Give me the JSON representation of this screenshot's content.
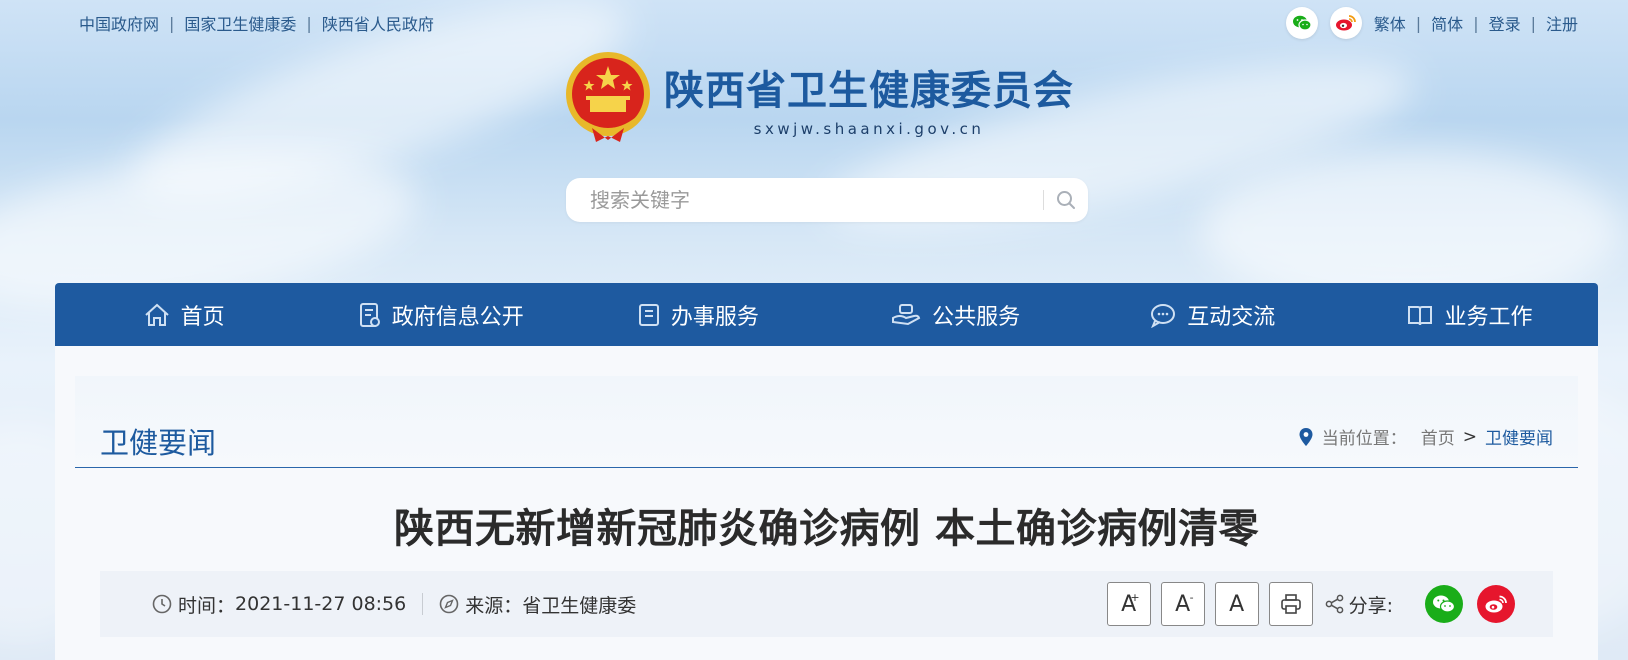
{
  "top_links": [
    "中国政府网",
    "国家卫生健康委",
    "陕西省人民政府"
  ],
  "top_right": {
    "traditional": "繁体",
    "simplified": "简体",
    "login": "登录",
    "register": "注册"
  },
  "logo": {
    "title": "陕西省卫生健康委员会",
    "domain": "sxwjw.shaanxi.gov.cn"
  },
  "search": {
    "placeholder": "搜索关键字"
  },
  "nav": [
    "首页",
    "政府信息公开",
    "办事服务",
    "公共服务",
    "互动交流",
    "业务工作"
  ],
  "section": {
    "title": "卫健要闻",
    "location_label": "当前位置：",
    "crumb_home": "首页",
    "crumb_sep": ">",
    "crumb_current": "卫健要闻"
  },
  "article": {
    "title": "陕西无新增新冠肺炎确诊病例 本土确诊病例清零",
    "time_label": "时间：",
    "time_value": "2021-11-27 08:56",
    "source_label": "来源：",
    "source_value": "省卫生健康委"
  },
  "tools": {
    "font_large": "A",
    "font_large_mark": "+",
    "font_small": "A",
    "font_small_mark": "-",
    "font_default": "A",
    "share_label": "分享:"
  },
  "colors": {
    "brand": "#1e5aa0",
    "wechat": "#1aad19",
    "weibo": "#e6162d"
  }
}
